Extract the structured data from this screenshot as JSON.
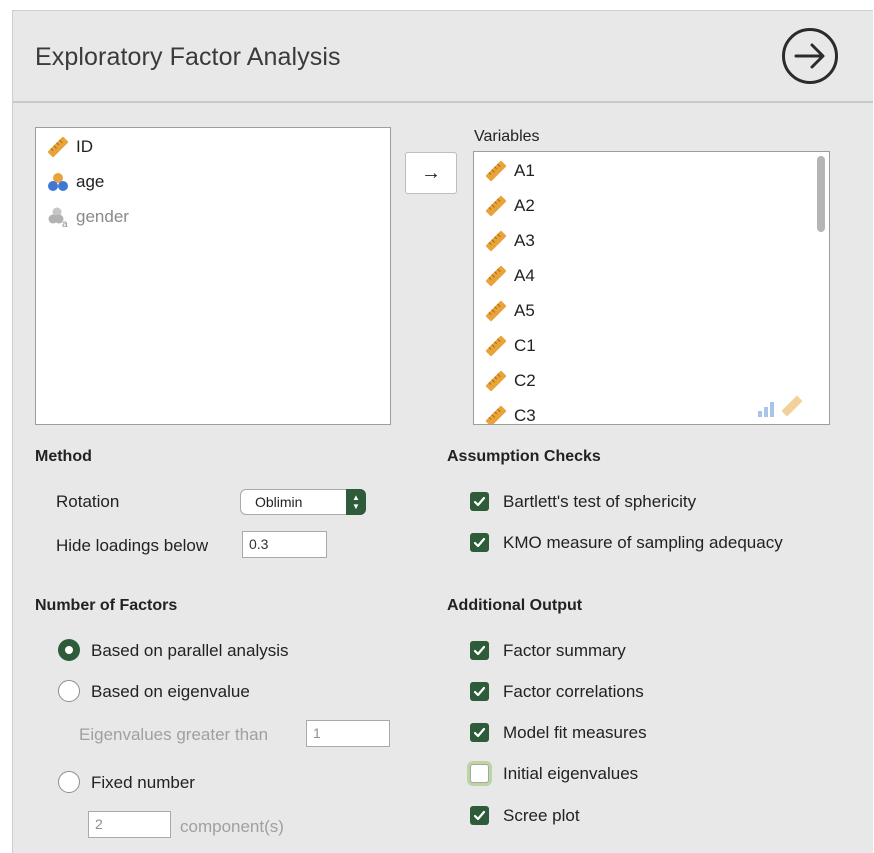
{
  "title": "Exploratory Factor Analysis",
  "source_list": [
    {
      "name": "ID",
      "type": "id",
      "disabled": false
    },
    {
      "name": "age",
      "type": "continuous",
      "disabled": false
    },
    {
      "name": "gender",
      "type": "nominal-text",
      "disabled": true
    }
  ],
  "variables_label": "Variables",
  "variables": [
    "A1",
    "A2",
    "A3",
    "A4",
    "A5",
    "C1",
    "C2",
    "C3"
  ],
  "move_button": "→",
  "method": {
    "heading": "Method",
    "rotation_label": "Rotation",
    "rotation_value": "Oblimin",
    "hide_label": "Hide loadings below",
    "hide_value": "0.3"
  },
  "assumption": {
    "heading": "Assumption Checks",
    "bartlett": "Bartlett's test of sphericity",
    "bartlett_checked": true,
    "kmo": "KMO measure of sampling adequacy",
    "kmo_checked": true
  },
  "factors": {
    "heading": "Number of Factors",
    "parallel": "Based on parallel analysis",
    "eigen": "Based on eigenvalue",
    "eigen_greater": "Eigenvalues greater than",
    "eigen_value": "1",
    "fixed": "Fixed number",
    "fixed_value": "2",
    "components": "component(s)",
    "selected": "parallel"
  },
  "additional": {
    "heading": "Additional Output",
    "summary": "Factor summary",
    "correlations": "Factor correlations",
    "fit": "Model fit measures",
    "initial": "Initial eigenvalues",
    "scree": "Scree plot",
    "checked": {
      "summary": true,
      "correlations": true,
      "fit": true,
      "initial": false,
      "scree": true
    }
  },
  "colors": {
    "accent": "#2e5c3a",
    "ruler": "#e8a43a",
    "panel": "#e8e8e8"
  }
}
